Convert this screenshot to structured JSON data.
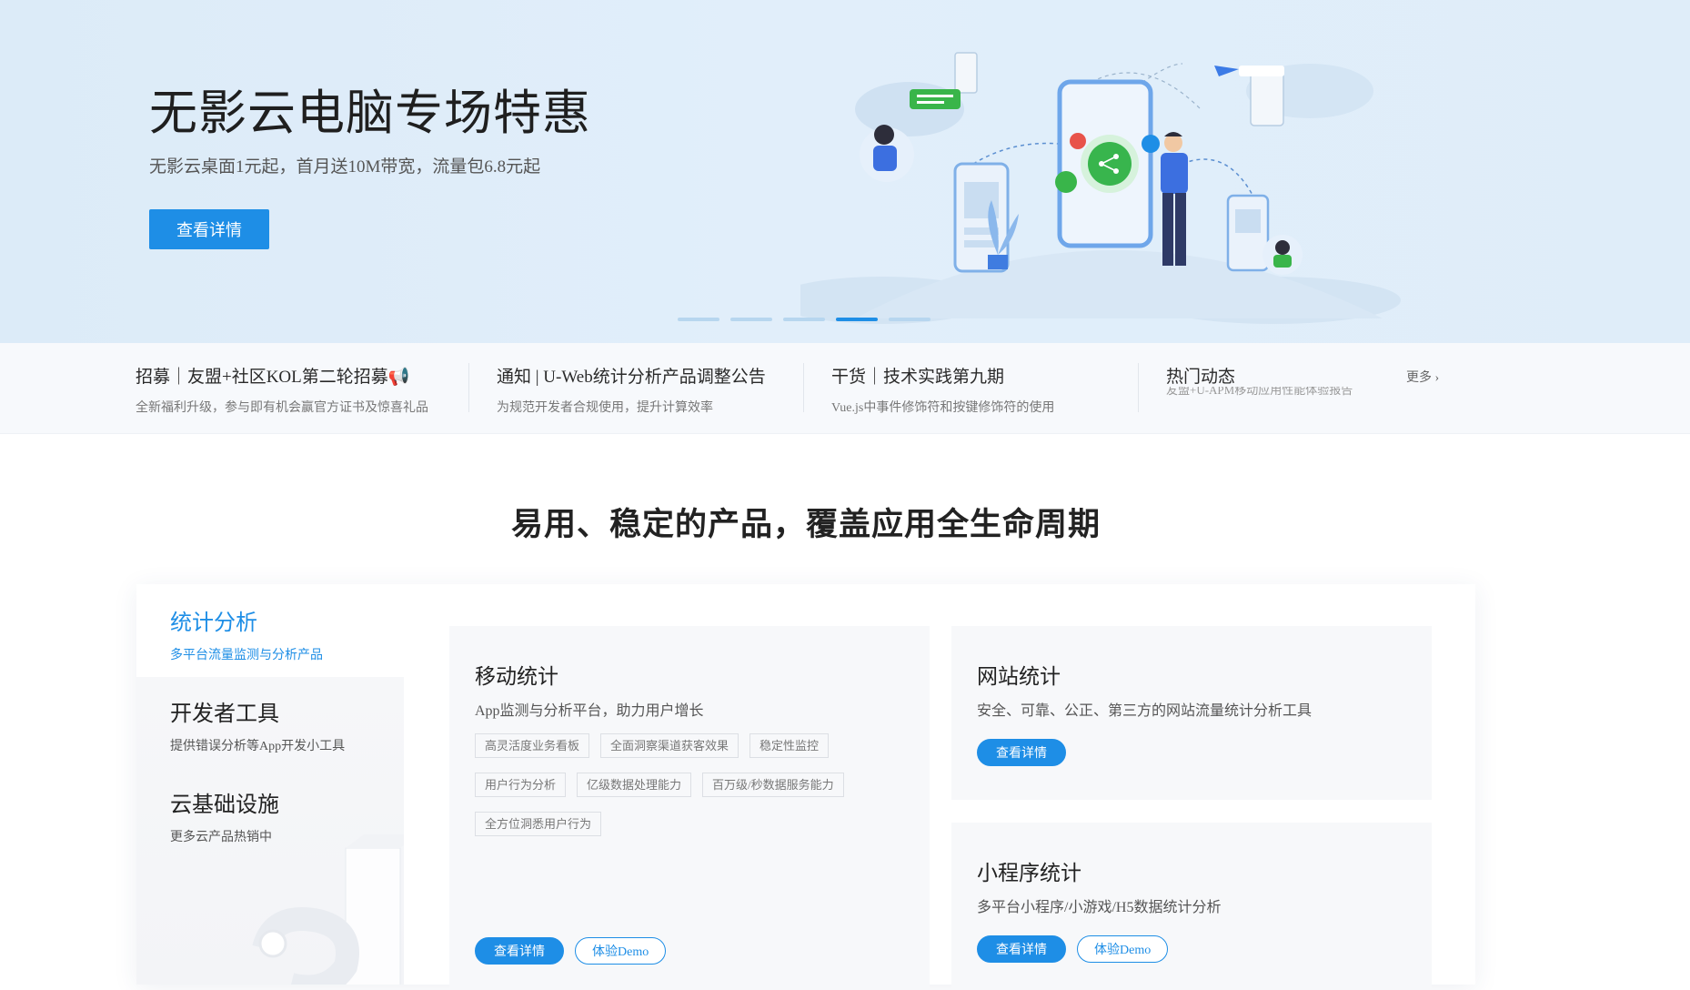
{
  "hero": {
    "title": "无影云电脑专场特惠",
    "subtitle": "无影云桌面1元起，首月送10M带宽，流量包6.8元起",
    "button": "查看详情",
    "slide_count": 5,
    "active_slide": 4
  },
  "news": {
    "items": [
      {
        "title": "招募｜友盟+社区KOL第二轮招募📢",
        "desc": "全新福利升级，参与即有机会赢官方证书及惊喜礼品"
      },
      {
        "title": "通知 | U-Web统计分析产品调整公告",
        "desc": "为规范开发者合规使用，提升计算效率"
      },
      {
        "title": "干货｜技术实践第九期",
        "desc": "Vue.js中事件修饰符和按键修饰符的使用"
      }
    ],
    "hot_title": "热门动态",
    "hot_ticker": "友盟+U-APM移动应用性能体验报告",
    "more": "更多 ›"
  },
  "section": {
    "title": "易用、稳定的产品，覆盖应用全生命周期"
  },
  "categories": [
    {
      "name": "统计分析",
      "desc": "多平台流量监测与分析产品",
      "active": true
    },
    {
      "name": "开发者工具",
      "desc": "提供错误分析等App开发小工具",
      "active": false
    },
    {
      "name": "云基础设施",
      "desc": "更多云产品热销中",
      "active": false
    }
  ],
  "products": {
    "mobile": {
      "title": "移动统计",
      "desc": "App监测与分析平台，助力用户增长",
      "tags": [
        "高灵活度业务看板",
        "全面洞察渠道获客效果",
        "稳定性监控",
        "用户行为分析",
        "亿级数据处理能力",
        "百万级/秒数据服务能力",
        "全方位洞悉用户行为"
      ],
      "primary": "查看详情",
      "demo": "体验Demo"
    },
    "web": {
      "title": "网站统计",
      "desc": "安全、可靠、公正、第三方的网站流量统计分析工具",
      "primary": "查看详情"
    },
    "mini": {
      "title": "小程序统计",
      "desc": "多平台小程序/小游戏/H5数据统计分析",
      "primary": "查看详情",
      "demo": "体验Demo"
    }
  },
  "colors": {
    "accent": "#1e8ee6",
    "hero_bg": "#dfedf9",
    "card_bg": "#f7f8fa"
  }
}
